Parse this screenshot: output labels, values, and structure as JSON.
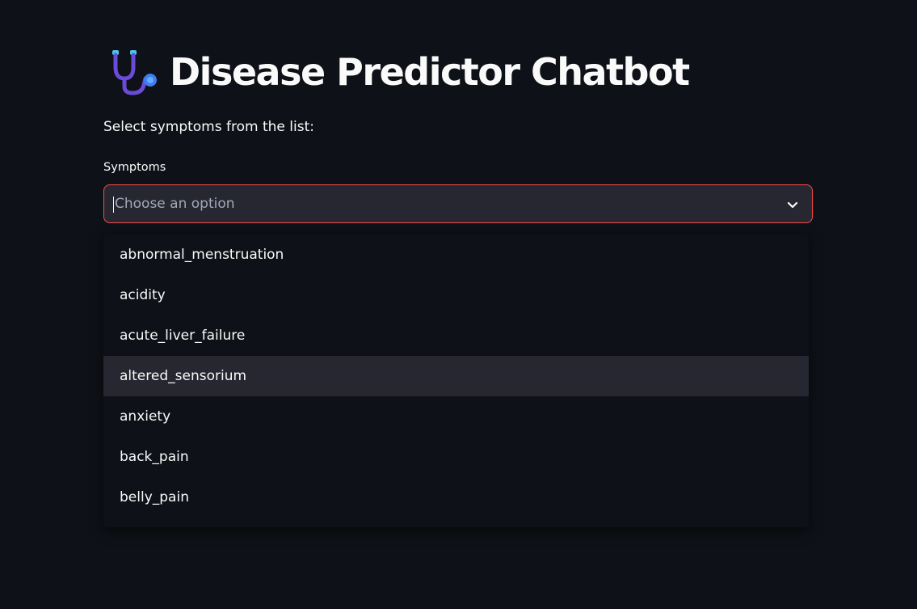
{
  "header": {
    "icon": "stethoscope-icon",
    "title": "Disease Predictor Chatbot"
  },
  "instructions": "Select symptoms from the list:",
  "symptoms_field": {
    "label": "Symptoms",
    "placeholder": "Choose an option",
    "chevron_icon": "chevron-down-icon",
    "border_color": "#ff4b4b"
  },
  "dropdown": {
    "options": [
      "abnormal_menstruation",
      "acidity",
      "acute_liver_failure",
      "altered_sensorium",
      "anxiety",
      "back_pain",
      "belly_pain"
    ],
    "highlighted_index": 3
  },
  "colors": {
    "background": "#0e1117",
    "input_background": "#262730",
    "accent": "#ff4b4b",
    "text": "#fafafa",
    "placeholder": "#a3a8b8"
  }
}
